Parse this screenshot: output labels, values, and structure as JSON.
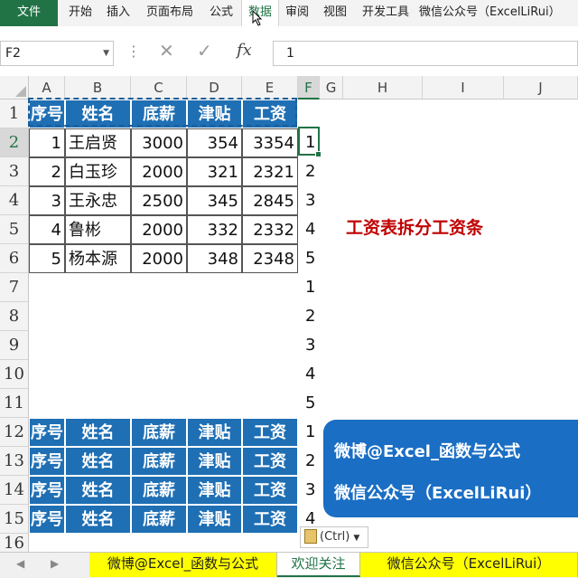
{
  "ribbon": {
    "tabs": [
      {
        "label": "文件",
        "kind": "file"
      },
      {
        "label": "开始",
        "kind": "normal"
      },
      {
        "label": "插入",
        "kind": "normal"
      },
      {
        "label": "页面布局",
        "kind": "normal"
      },
      {
        "label": "公式",
        "kind": "normal"
      },
      {
        "label": "数据",
        "kind": "active"
      },
      {
        "label": "审阅",
        "kind": "normal"
      },
      {
        "label": "视图",
        "kind": "normal"
      },
      {
        "label": "开发工具",
        "kind": "normal"
      },
      {
        "label": "微信公众号（ExcelLiRui）",
        "kind": "normal"
      }
    ]
  },
  "formula_bar": {
    "name_box": "F2",
    "fx_label": "fx",
    "formula": "1"
  },
  "sheet": {
    "columns": [
      "A",
      "B",
      "C",
      "D",
      "E",
      "F",
      "G",
      "H",
      "I",
      "J"
    ],
    "selected_column": "F",
    "rows": [
      "1",
      "2",
      "3",
      "4",
      "5",
      "6",
      "7",
      "8",
      "9",
      "10",
      "11",
      "12",
      "13",
      "14",
      "15",
      "16"
    ],
    "selected_row": "2",
    "header": [
      "序号",
      "姓名",
      "底薪",
      "津贴",
      "工资"
    ],
    "data": [
      [
        "1",
        "王启贤",
        "3000",
        "354",
        "3354"
      ],
      [
        "2",
        "白玉珍",
        "2000",
        "321",
        "2321"
      ],
      [
        "3",
        "王永忠",
        "2500",
        "345",
        "2845"
      ],
      [
        "4",
        "鲁彬",
        "2000",
        "332",
        "2332"
      ],
      [
        "5",
        "杨本源",
        "2000",
        "348",
        "2348"
      ]
    ],
    "pasted_header_rows": 4,
    "f_values": [
      "1",
      "2",
      "3",
      "4",
      "5",
      "1",
      "2",
      "3",
      "4",
      "5",
      "1",
      "2",
      "3",
      "4"
    ],
    "title": "工资表拆分工资条",
    "banner": {
      "line1": "微博@Excel_函数与公式",
      "line2": "微信公众号（ExcelLiRui）",
      "color": "#1a6ec4"
    },
    "paste_options": "(Ctrl)"
  },
  "sheet_tabs": [
    {
      "label": "微博@Excel_函数与公式",
      "style": "yellow"
    },
    {
      "label": "欢迎关注",
      "style": "active"
    },
    {
      "label": "微信公众号（ExcelLiRui）",
      "style": "yellow"
    }
  ],
  "colors": {
    "accent": "#217346",
    "header_fill": "#1f6fb4",
    "title": "#c00000"
  }
}
